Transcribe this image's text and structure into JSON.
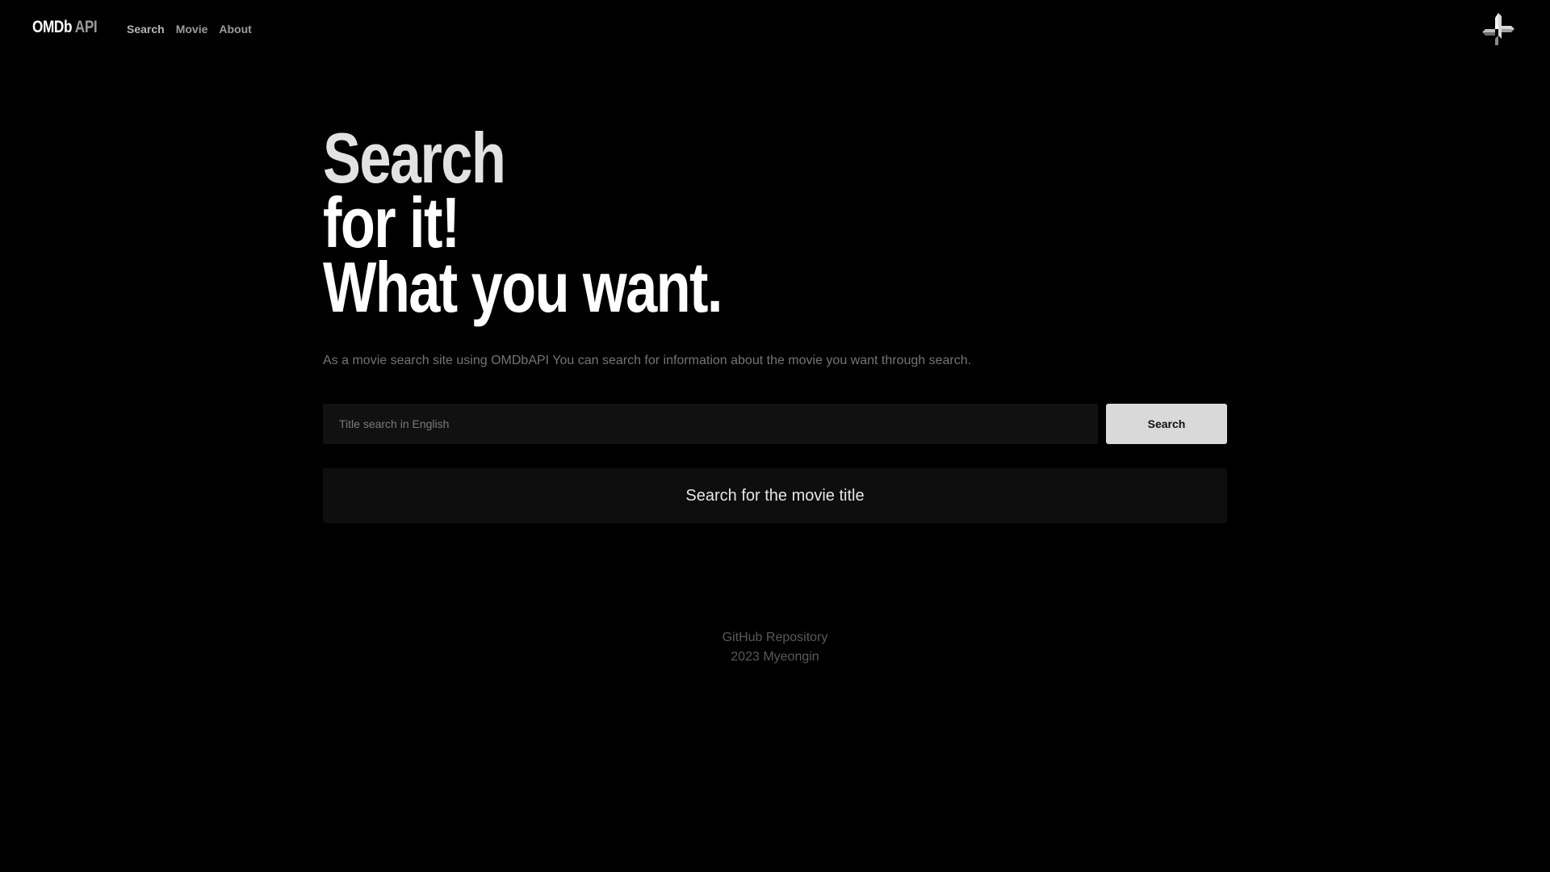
{
  "header": {
    "brand_main": "OMDb",
    "brand_sub": " API",
    "nav": [
      {
        "label": "Search"
      },
      {
        "label": "Movie"
      },
      {
        "label": "About"
      }
    ],
    "logo_icon": "cross-arrow-logo-icon"
  },
  "hero": {
    "headline_line_1": "Search",
    "headline_line_2": "for it!",
    "headline_line_3": "What you want.",
    "description": "As a movie search site using OMDbAPI You can search for information about the movie you want through search."
  },
  "search": {
    "input_value": "",
    "placeholder": "Title search in English",
    "button_label": "Search"
  },
  "result": {
    "message": "Search for the movie title"
  },
  "footer": {
    "repo_link": "GitHub Repository",
    "copyright": "2023 Myeongin"
  },
  "colors": {
    "background": "#000000",
    "input_background": "#111111",
    "button_background": "#d9d9d9",
    "muted_text": "#747474"
  }
}
